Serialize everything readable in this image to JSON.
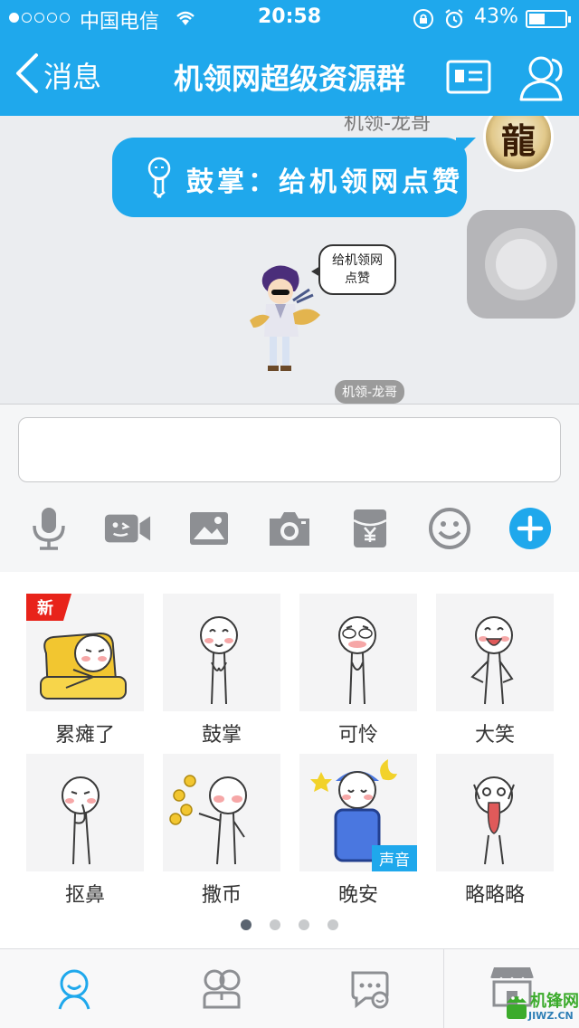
{
  "status_bar": {
    "carrier": "中国电信",
    "time": "20:58",
    "battery_percent": "43%",
    "battery_level": 0.43,
    "signal_bars": 1
  },
  "nav": {
    "back_label": "消息",
    "title": "机领网超级资源群",
    "icons": [
      "chevron-left-icon",
      "profile-card-icon",
      "group-members-icon"
    ]
  },
  "chat": {
    "top_sender": "机领-龙哥",
    "avatar_text": "龍",
    "bubble_text": "鼓掌：给机领网点赞",
    "speech_text": [
      "给机领网",
      "点赞"
    ],
    "name_tag": "机领-龙哥"
  },
  "input": {
    "value": "",
    "placeholder": ""
  },
  "toolbar": [
    "microphone-icon",
    "video-call-icon",
    "image-icon",
    "camera-icon",
    "red-packet-icon",
    "emoji-icon",
    "plus-icon"
  ],
  "stickers": [
    {
      "label": "累瘫了",
      "badge": "新"
    },
    {
      "label": "鼓掌",
      "badge": ""
    },
    {
      "label": "可怜",
      "badge": ""
    },
    {
      "label": "大笑",
      "badge": ""
    },
    {
      "label": "抠鼻",
      "badge": ""
    },
    {
      "label": "撒币",
      "badge": ""
    },
    {
      "label": "晚安",
      "badge": "声音"
    },
    {
      "label": "略略略",
      "badge": ""
    }
  ],
  "pager": {
    "pages": 4,
    "current": 1
  },
  "bottom_tabs": [
    "doodle-face-icon",
    "friends-icon",
    "chat-bubble-icon",
    "store-icon"
  ],
  "watermark": {
    "text": "机锋网",
    "url": "JIWZ.CN"
  },
  "colors": {
    "accent": "#1fa8ec",
    "badge_red": "#e8231a"
  }
}
